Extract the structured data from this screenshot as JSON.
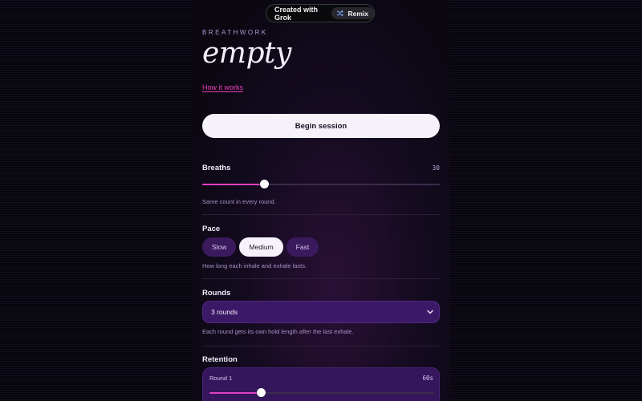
{
  "badge": {
    "text": "Created with Grok",
    "remix_label": "Remix"
  },
  "header": {
    "eyebrow": "BREATHWORK",
    "title": "empty",
    "link": "How it works"
  },
  "begin_label": "Begin session",
  "breaths": {
    "label": "Breaths",
    "value": "30",
    "hint": "Same count in every round.",
    "fraction": 0.26
  },
  "pace": {
    "label": "Pace",
    "options": [
      "Slow",
      "Medium",
      "Fast"
    ],
    "selected": "Medium",
    "hint": "How long each inhale and exhale lasts."
  },
  "rounds": {
    "label": "Rounds",
    "selected": "3 rounds",
    "hint": "Each round gets its own hold length after the last exhale."
  },
  "retention": {
    "label": "Retention",
    "round1": {
      "label": "Round 1",
      "value": "60s",
      "fraction": 0.23
    }
  },
  "colors": {
    "accent": "#e23fc0",
    "link": "#e640b9",
    "card": "#35165c"
  },
  "icons": {
    "remix": "shuffle-icon",
    "select": "chevron-down-icon"
  }
}
